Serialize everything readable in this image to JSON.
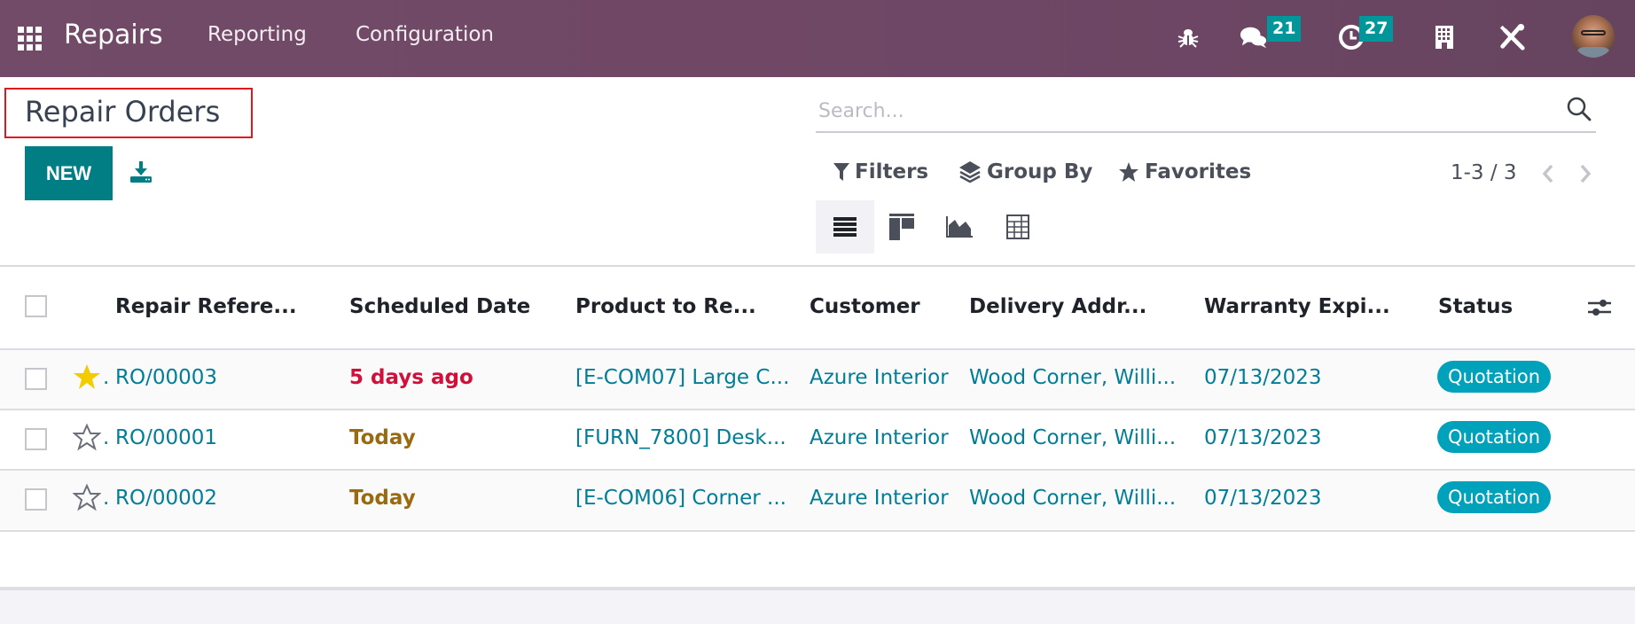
{
  "navbar": {
    "app_name": "Repairs",
    "menus": [
      "Reporting",
      "Configuration"
    ],
    "messages_count": "21",
    "activities_count": "27",
    "colors": {
      "background": "#714b67",
      "badge": "#01979a"
    }
  },
  "page": {
    "title": "Repair Orders",
    "new_label": "NEW"
  },
  "search": {
    "placeholder": "Search...",
    "value": ""
  },
  "controls": {
    "filters_label": "Filters",
    "groupby_label": "Group By",
    "favorites_label": "Favorites",
    "pager": "1-3 / 3"
  },
  "views": [
    "list",
    "kanban",
    "graph",
    "pivot"
  ],
  "table": {
    "columns": [
      "Repair Refere...",
      "Scheduled Date",
      "Product to Re...",
      "Customer",
      "Delivery Addr...",
      "Warranty Expi...",
      "Status"
    ],
    "rows": [
      {
        "starred": true,
        "reference": "RO/00003",
        "scheduled": "5 days ago",
        "scheduled_state": "overdue",
        "product": "[E-COM07] Large C...",
        "customer": "Azure Interior",
        "delivery": "Wood Corner, Willi...",
        "warranty": "07/13/2023",
        "status": "Quotation"
      },
      {
        "starred": false,
        "reference": "RO/00001",
        "scheduled": "Today",
        "scheduled_state": "today",
        "product": "[FURN_7800] Desk...",
        "customer": "Azure Interior",
        "delivery": "Wood Corner, Willi...",
        "warranty": "07/13/2023",
        "status": "Quotation"
      },
      {
        "starred": false,
        "reference": "RO/00002",
        "scheduled": "Today",
        "scheduled_state": "today",
        "product": "[E-COM06] Corner ...",
        "customer": "Azure Interior",
        "delivery": "Wood Corner, Willi...",
        "warranty": "07/13/2023",
        "status": "Quotation"
      }
    ],
    "colors": {
      "overdue": "#d0103a",
      "today": "#9a6a10",
      "link": "#017e97",
      "status": "#00a2bb",
      "star": "#f3cc00"
    }
  }
}
